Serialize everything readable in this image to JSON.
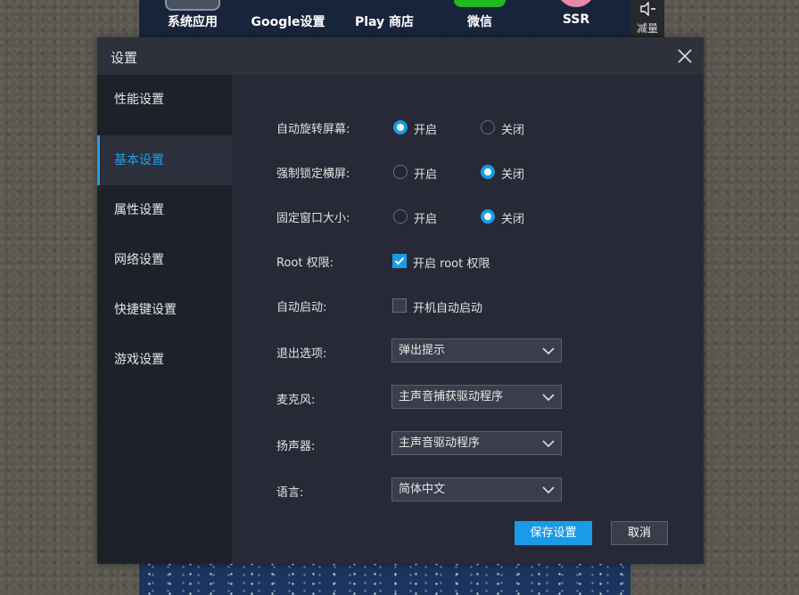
{
  "background_apps": [
    {
      "label": "系统应用",
      "icon": "system-apps-icon",
      "color": "#4a5160"
    },
    {
      "label": "Google设置",
      "icon": "google-settings-icon",
      "color": "#6c7382"
    },
    {
      "label": "Play 商店",
      "icon": "play-store-icon",
      "color": "#e8e8e8"
    },
    {
      "label": "微信",
      "icon": "wechat-icon",
      "color": "#1fb922"
    },
    {
      "label": "SSR",
      "icon": "ssr-icon",
      "color": "#e58aa8"
    }
  ],
  "side_toolbar": {
    "volume_down_label": "减量",
    "icon": "volume-down-icon"
  },
  "dialog": {
    "title": "设置",
    "nav": [
      "性能设置",
      "基本设置",
      "属性设置",
      "网络设置",
      "快捷键设置",
      "游戏设置"
    ],
    "active_nav": "基本设置",
    "settings": {
      "auto_rotate": {
        "label": "自动旋转屏幕:",
        "on": "开启",
        "off": "关闭",
        "selected": "开启"
      },
      "force_landscape": {
        "label": "强制锁定横屏:",
        "on": "开启",
        "off": "关闭",
        "selected": "关闭"
      },
      "fixed_window": {
        "label": "固定窗口大小:",
        "on": "开启",
        "off": "关闭",
        "selected": "关闭"
      },
      "root": {
        "label": "Root 权限:",
        "checkbox_label": "开启 root 权限",
        "checked": true
      },
      "autostart": {
        "label": "自动启动:",
        "checkbox_label": "开机自动启动",
        "checked": false
      },
      "exit_option": {
        "label": "退出选项:",
        "value": "弹出提示"
      },
      "microphone": {
        "label": "麦克风:",
        "value": "主声音捕获驱动程序"
      },
      "speaker": {
        "label": "扬声器:",
        "value": "主声音驱动程序"
      },
      "language": {
        "label": "语言:",
        "value": "简体中文"
      }
    },
    "save_label": "保存设置",
    "cancel_label": "取消"
  },
  "colors": {
    "accent": "#1a9be8",
    "dialog_bg": "#272a36",
    "sidebar_bg": "#1f212a"
  }
}
